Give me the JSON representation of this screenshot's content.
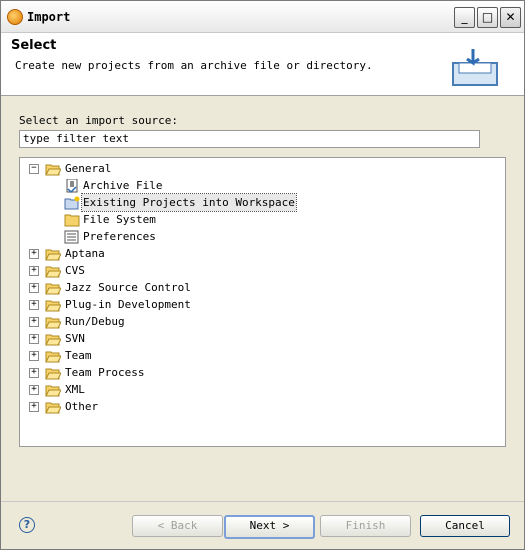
{
  "window": {
    "title": "Import",
    "title_underline": "I",
    "minimize": "_",
    "maximize": "□",
    "close": "✕"
  },
  "header": {
    "title": "Select",
    "description": "Create new projects from an archive file or directory."
  },
  "source_label": "Select an import source:",
  "filter": {
    "value": "type filter text"
  },
  "tree": {
    "general": {
      "label": "General",
      "expand": "−"
    },
    "children": [
      {
        "label": "Archive File"
      },
      {
        "label": "Existing Projects into Workspace"
      },
      {
        "label": "File System"
      },
      {
        "label": "Preferences"
      }
    ],
    "categories": [
      {
        "label": "Aptana"
      },
      {
        "label": "CVS"
      },
      {
        "label": "Jazz Source Control"
      },
      {
        "label": "Plug-in Development"
      },
      {
        "label": "Run/Debug"
      },
      {
        "label": "SVN"
      },
      {
        "label": "Team"
      },
      {
        "label": "Team Process"
      },
      {
        "label": "XML"
      },
      {
        "label": "Other"
      }
    ],
    "expand_plus": "+"
  },
  "buttons": {
    "back": "< Back",
    "next": "Next >",
    "finish": "Finish",
    "cancel": "Cancel",
    "help": "?"
  }
}
